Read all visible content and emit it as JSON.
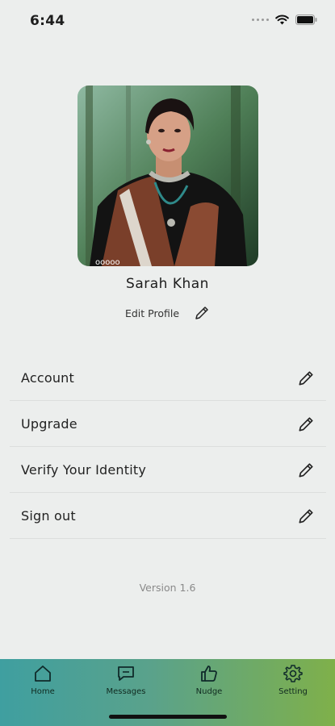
{
  "status": {
    "time": "6:44"
  },
  "profile": {
    "name": "Sarah Khan",
    "edit_label": "Edit Profile"
  },
  "menu": [
    {
      "label": "Account"
    },
    {
      "label": "Upgrade"
    },
    {
      "label": "Verify Your Identity"
    },
    {
      "label": "Sign out"
    }
  ],
  "version": "Version 1.6",
  "tabs": [
    {
      "label": "Home",
      "icon": "home-icon"
    },
    {
      "label": "Messages",
      "icon": "message-icon"
    },
    {
      "label": "Nudge",
      "icon": "thumbs-up-icon"
    },
    {
      "label": "Setting",
      "icon": "gear-icon"
    }
  ],
  "colors": {
    "background": "#eceeed",
    "tab_gradient_start": "#3f9fa0",
    "tab_gradient_end": "#7fb04a"
  }
}
